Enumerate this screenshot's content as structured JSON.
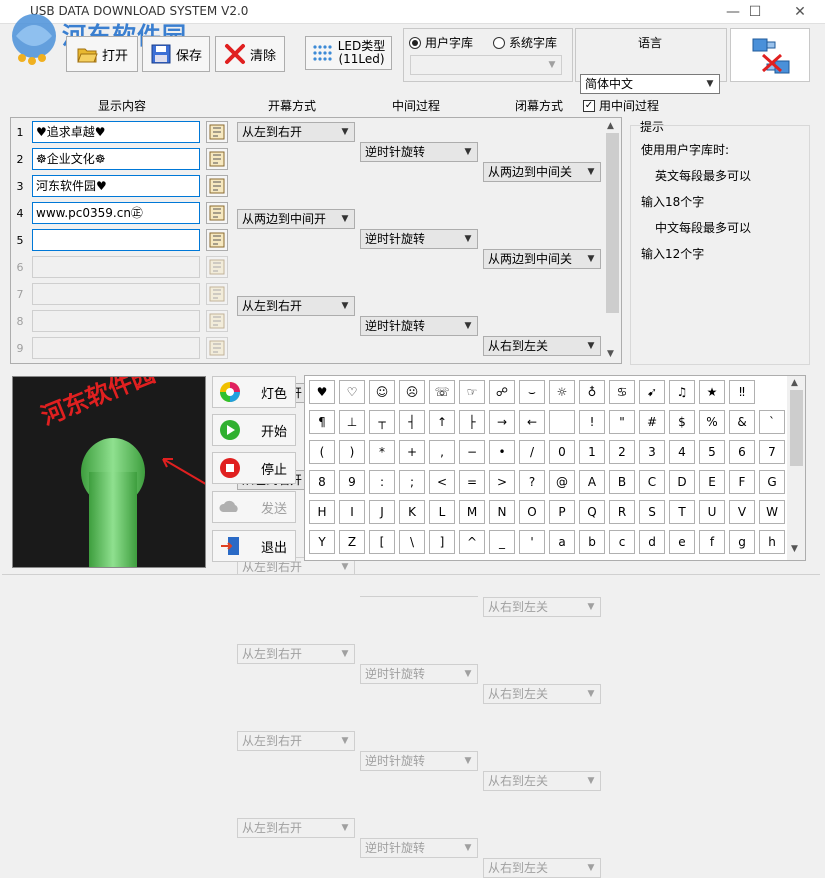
{
  "window": {
    "title": "USB DATA DOWNLOAD SYSTEM V2.0",
    "minimize": "—",
    "maximize": "☐",
    "close": "✕"
  },
  "watermark": {
    "text": "河东软件园",
    "url": "www.pc0359.cn"
  },
  "toolbar": {
    "open_label": "打开",
    "save_label": "保存",
    "clear_label": "清除",
    "led_type_label": "LED类型",
    "led_type_value": "(11Led)"
  },
  "font_source": {
    "user": "用户字库",
    "system": "系统字库",
    "selected": "user",
    "combo_value": ""
  },
  "language": {
    "label": "语言",
    "value": "简体中文"
  },
  "table": {
    "headers": {
      "content": "显示内容",
      "open": "开幕方式",
      "middle": "中间过程",
      "close": "闭幕方式",
      "use_middle": "用中间过程"
    },
    "use_middle_checked": true,
    "rows": [
      {
        "num": "1",
        "text": "♥追求卓越♥",
        "open": "从左到右开",
        "middle": "逆时针旋转",
        "close": "从两边到中间关",
        "enabled": true
      },
      {
        "num": "2",
        "text": "☸企业文化☸",
        "open": "从两边到中间开",
        "middle": "逆时针旋转",
        "close": "从两边到中间关",
        "enabled": true
      },
      {
        "num": "3",
        "text": "河东软件园♥",
        "open": "从左到右开",
        "middle": "逆时针旋转",
        "close": "从右到左关",
        "enabled": true
      },
      {
        "num": "4",
        "text": "www.pc0359.cn㊣",
        "open": "从左到右开",
        "middle": "逆时针旋转",
        "close": "从右到左关",
        "enabled": true
      },
      {
        "num": "5",
        "text": "",
        "open": "从左到右开",
        "middle": "逆时针旋转",
        "close": "从右到左关",
        "enabled": true
      },
      {
        "num": "6",
        "text": "",
        "open": "从左到右开",
        "middle": "逆时针旋转",
        "close": "从右到左关",
        "enabled": false
      },
      {
        "num": "7",
        "text": "",
        "open": "从左到右开",
        "middle": "逆时针旋转",
        "close": "从右到左关",
        "enabled": false
      },
      {
        "num": "8",
        "text": "",
        "open": "从左到右开",
        "middle": "逆时针旋转",
        "close": "从右到左关",
        "enabled": false
      },
      {
        "num": "9",
        "text": "",
        "open": "从左到右开",
        "middle": "逆时针旋转",
        "close": "从右到左关",
        "enabled": false
      }
    ]
  },
  "tips": {
    "title": "提示",
    "lines": [
      "使用用户字库时:",
      "英文每段最多可以",
      "输入18个字",
      "中文每段最多可以",
      "输入12个字"
    ]
  },
  "preview": {
    "text": "河东软件园♥"
  },
  "side_buttons": {
    "light": "灯色",
    "start": "开始",
    "stop": "停止",
    "send": "发送",
    "exit": "退出"
  },
  "char_grid": [
    [
      "♥",
      "♡",
      "☺",
      "☹",
      "☏",
      "☞",
      "☍",
      "⌣",
      "☼",
      "♁",
      "♋",
      "➹",
      "♫",
      "★",
      "‼"
    ],
    [
      "¶",
      "⊥",
      "┬",
      "┤",
      "↑",
      "├",
      "→",
      "←",
      "",
      "!",
      "\"",
      "#",
      "$",
      "%",
      "&",
      "`"
    ],
    [
      "(",
      ")",
      "*",
      "+",
      ",",
      "−",
      "•",
      "/",
      "0",
      "1",
      "2",
      "3",
      "4",
      "5",
      "6",
      "7"
    ],
    [
      "8",
      "9",
      ":",
      ";",
      "<",
      "=",
      ">",
      "?",
      "@",
      "A",
      "B",
      "C",
      "D",
      "E",
      "F",
      "G"
    ],
    [
      "H",
      "I",
      "J",
      "K",
      "L",
      "M",
      "N",
      "O",
      "P",
      "Q",
      "R",
      "S",
      "T",
      "U",
      "V",
      "W"
    ],
    [
      "Y",
      "Z",
      "[",
      "\\",
      "]",
      "^",
      "_",
      "'",
      "a",
      "b",
      "c",
      "d",
      "e",
      "f",
      "g",
      "h"
    ]
  ],
  "colors": {
    "accent": "#0078d7",
    "led_red": "#e02020",
    "fan_green": "#5ec45e"
  }
}
